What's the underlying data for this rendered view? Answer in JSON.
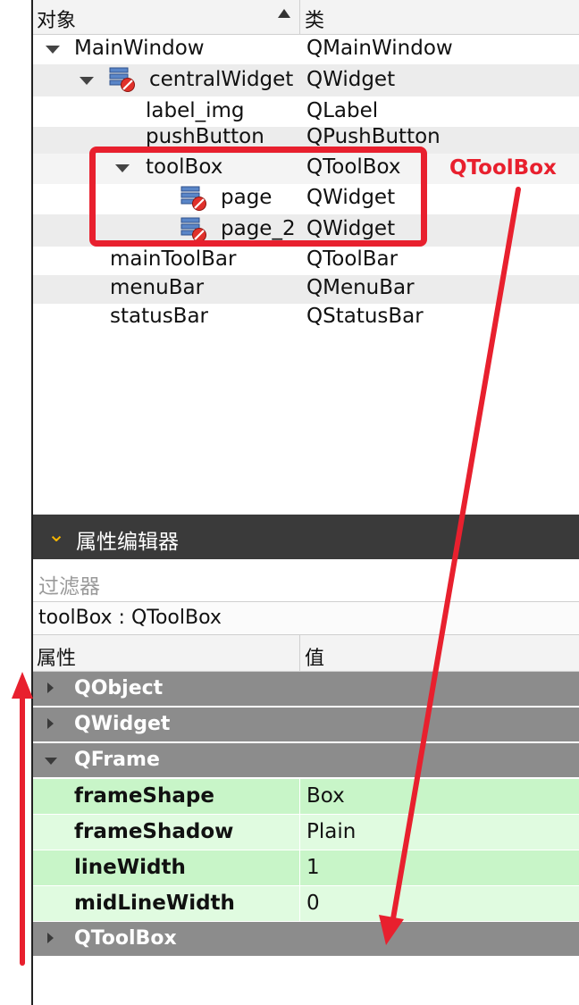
{
  "object_inspector": {
    "header": {
      "col_object": "对象",
      "col_class": "类",
      "sort_icon": "sort-ascending-icon"
    },
    "rows": [
      {
        "name": "MainWindow",
        "cls": "QMainWindow",
        "expanded": true
      },
      {
        "name": "centralWidget",
        "cls": "QWidget",
        "expanded": true,
        "icon": "layout-broken-icon"
      },
      {
        "name": "label_img",
        "cls": "QLabel"
      },
      {
        "name": "pushButton",
        "cls": "QPushButton"
      },
      {
        "name": "toolBox",
        "cls": "QToolBox",
        "expanded": true
      },
      {
        "name": "page",
        "cls": "QWidget",
        "icon": "layout-broken-icon"
      },
      {
        "name": "page_2",
        "cls": "QWidget",
        "icon": "layout-broken-icon"
      },
      {
        "name": "mainToolBar",
        "cls": "QToolBar"
      },
      {
        "name": "menuBar",
        "cls": "QMenuBar"
      },
      {
        "name": "statusBar",
        "cls": "QStatusBar"
      }
    ]
  },
  "property_editor": {
    "title": "属性编辑器",
    "chevron_icon": "chevron-down-icon",
    "filter_placeholder": "过滤器",
    "object_label": "toolBox : QToolBox",
    "header": {
      "col_property": "属性",
      "col_value": "值"
    },
    "groups": [
      {
        "name": "QObject",
        "expanded": false
      },
      {
        "name": "QWidget",
        "expanded": false
      },
      {
        "name": "QFrame",
        "expanded": true
      },
      {
        "name": "QToolBox",
        "expanded": false
      }
    ],
    "qframe_properties": [
      {
        "name": "frameShape",
        "value": "Box"
      },
      {
        "name": "frameShadow",
        "value": "Plain"
      },
      {
        "name": "lineWidth",
        "value": "1"
      },
      {
        "name": "midLineWidth",
        "value": "0"
      }
    ]
  },
  "annotation": {
    "label": "QToolBox",
    "color": "#e8202e"
  },
  "colors": {
    "group_bg": "#8c8c8c",
    "prop_row_a": "#c8f5c8",
    "prop_row_b": "#e0fbe0",
    "title_bar": "#3a3a3a",
    "chevron": "#f4b400"
  }
}
